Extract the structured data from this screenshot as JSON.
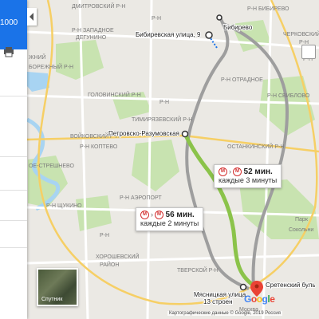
{
  "panel": {
    "header_text": "1000",
    "print_icon": "print-icon",
    "collapse_icon": "chevron-left-icon"
  },
  "map": {
    "districts": [
      {
        "key": "d1",
        "text": "ДМИТРОВСКИЙ Р-Н"
      },
      {
        "key": "d2",
        "text": "Р-Н"
      },
      {
        "key": "d3",
        "text": "Р-Н ЗАПАДНОЕ"
      },
      {
        "key": "d4",
        "text": "ДЕГУНИНО"
      },
      {
        "key": "d5",
        "text": "ЖНИЙ"
      },
      {
        "key": "d6",
        "text": "БОРЕЖНЫЙ Р-Н"
      },
      {
        "key": "d7",
        "text": "ГОЛОВИНСКИЙ Р-Н"
      },
      {
        "key": "d8",
        "text": "ТИМИРЯЗЕВСКИЙ Р-Н"
      },
      {
        "key": "d9",
        "text": "ВОЙКОВСКИЙ Р-Н"
      },
      {
        "key": "d10",
        "text": "Р-Н КОПТЕВО"
      },
      {
        "key": "d11",
        "text": "ОЕ-СТРЕШНЕВО"
      },
      {
        "key": "d12",
        "text": "Р-Н АЭРОПОРТ"
      },
      {
        "key": "d13",
        "text": "Р-Н ЩУКИНО"
      },
      {
        "key": "d14",
        "text": "Р-Н"
      },
      {
        "key": "d15",
        "text": "ХОРОШЕВСКИЙ"
      },
      {
        "key": "d16",
        "text": "РАЙОН"
      },
      {
        "key": "d17",
        "text": "ТВЕРСКОЙ Р-Н"
      },
      {
        "key": "d18",
        "text": "Р-Н"
      },
      {
        "key": "d19",
        "text": "ОСТАНКИНСКИЙ Р-Н"
      },
      {
        "key": "d20",
        "text": "Р-Н ОТРАДНОЕ"
      },
      {
        "key": "d21",
        "text": "Р-Н СВИБЛОВО"
      },
      {
        "key": "d22",
        "text": "ЧЕРКОВСКИЙ"
      },
      {
        "key": "d23",
        "text": "Р-Н"
      },
      {
        "key": "d24",
        "text": "Р-Н БИБИРЕВО"
      },
      {
        "key": "d25",
        "text": "Р-Н"
      },
      {
        "key": "d26",
        "text": "Парк"
      },
      {
        "key": "d27",
        "text": "Сокольни"
      },
      {
        "key": "d28",
        "text": "Москва"
      }
    ],
    "place_labels": [
      {
        "key": "p1",
        "text": "Бибиревская улица, 9"
      },
      {
        "key": "p2",
        "text": "Бибирево"
      },
      {
        "key": "p3",
        "text": "Петровско-Разумовская"
      },
      {
        "key": "p4",
        "text": "Сретенский буль"
      },
      {
        "key": "p5",
        "text": "Мясницкая улица,"
      },
      {
        "key": "p6",
        "text": "13 строен"
      }
    ]
  },
  "routes": [
    {
      "metro": "М",
      "time": "52 мин.",
      "freq": "каждые 3 минуты"
    },
    {
      "metro": "М",
      "time": "56 мин.",
      "freq": "каждые 2 минуты"
    }
  ],
  "satellite": {
    "label": "Спутник"
  },
  "logo": {
    "text": "Google"
  },
  "attribution": "Картографические данные © Google, 2019   Россия",
  "colors": {
    "route_primary": "#8bc34a",
    "route_alt": "#9e9e9e",
    "destination": "#ea4335",
    "header": "#1a73e8"
  }
}
